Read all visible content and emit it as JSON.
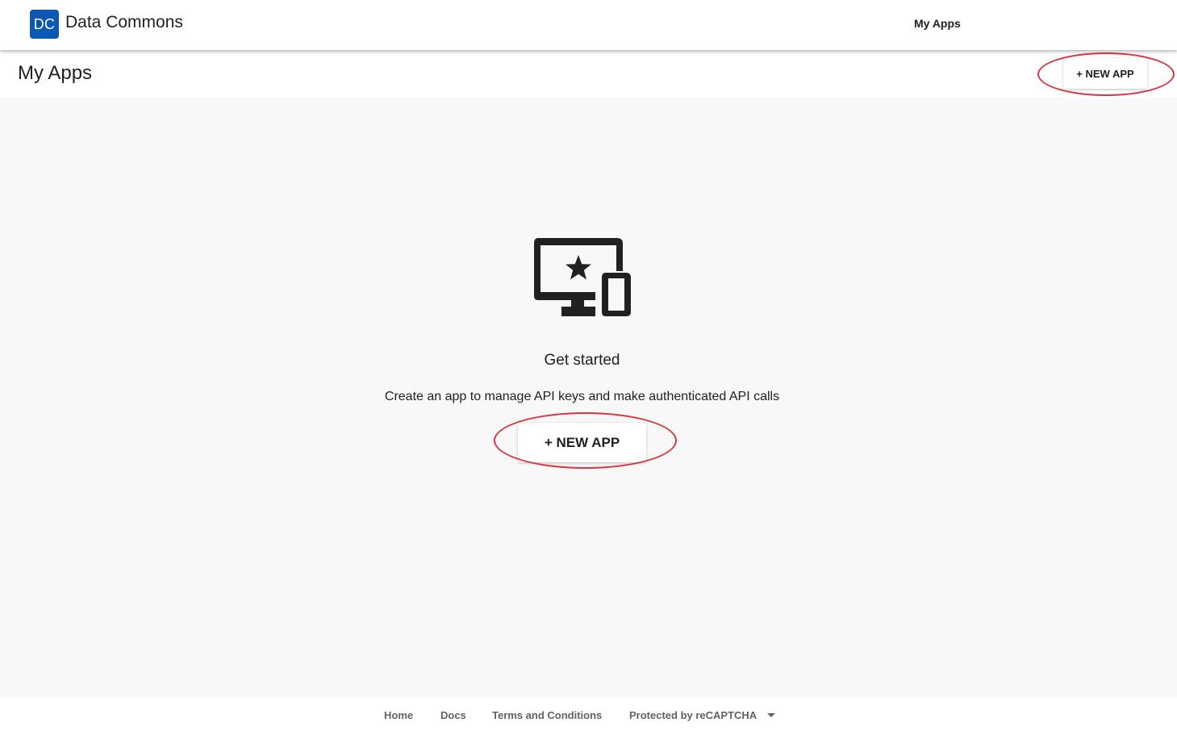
{
  "appbar": {
    "logo_text": "DC",
    "brand": "Data Commons",
    "nav_my_apps": "My Apps",
    "logo_color": "#0b57b2"
  },
  "page_header": {
    "title": "My Apps",
    "new_app_button": "+ NEW APP"
  },
  "empty_state": {
    "icon": "desktop-mobile-star-icon",
    "heading": "Get started",
    "description": "Create an app to manage API keys and make authenticated API calls",
    "new_app_button": "+ NEW APP"
  },
  "annotations": {
    "highlight_color": "#d9343b"
  },
  "footer": {
    "links": [
      "Home",
      "Docs",
      "Terms and Conditions",
      "Protected by reCAPTCHA"
    ],
    "recaptcha_icon": "caret-down-icon"
  }
}
